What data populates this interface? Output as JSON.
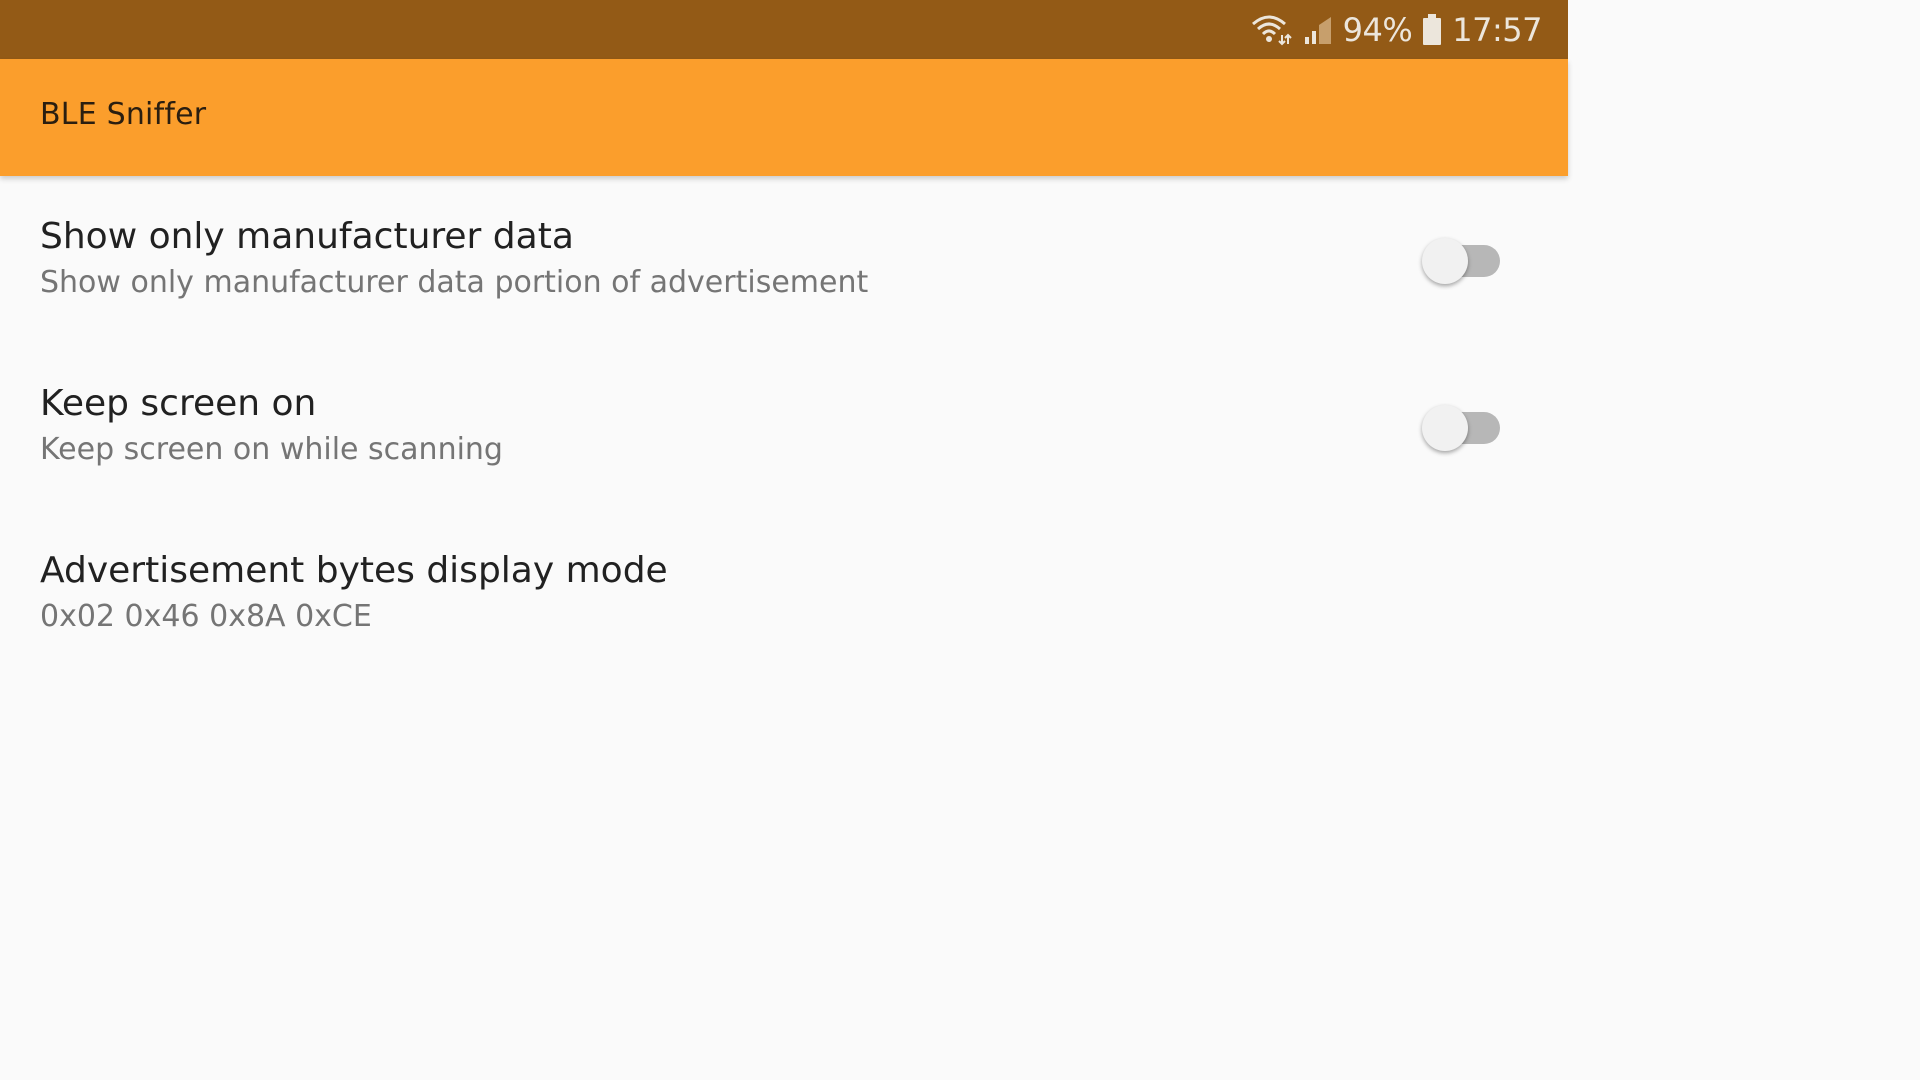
{
  "status_bar": {
    "battery_percent": "94%",
    "time": "17:57",
    "icons": [
      "wifi-icon",
      "signal-icon",
      "battery-icon"
    ],
    "color": "#935a16"
  },
  "app_bar": {
    "title": "BLE Sniffer",
    "color": "#fb9e2c"
  },
  "preferences": [
    {
      "title": "Show only manufacturer data",
      "summary": "Show only manufacturer data portion of advertisement",
      "has_switch": true,
      "checked": false
    },
    {
      "title": "Keep screen on",
      "summary": "Keep screen on while scanning",
      "has_switch": true,
      "checked": false
    },
    {
      "title": "Advertisement bytes display mode",
      "summary": "0x02 0x46 0x8A 0xCE",
      "has_switch": false
    }
  ]
}
